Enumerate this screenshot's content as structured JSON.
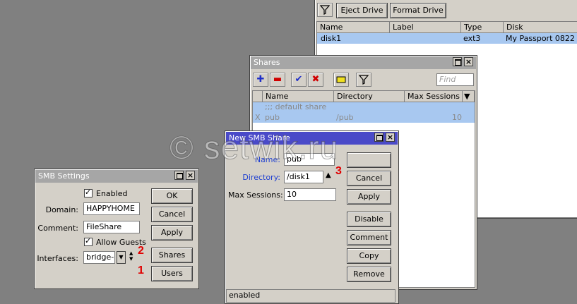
{
  "disks_window": {
    "toolbar": {
      "eject_label": "Eject Drive",
      "format_label": "Format Drive"
    },
    "columns": [
      "Name",
      "Label",
      "Type",
      "Disk"
    ],
    "rows": [
      {
        "name": "disk1",
        "label": "",
        "type": "ext3",
        "disk": "My Passport 0822"
      }
    ]
  },
  "shares_window": {
    "title": "Shares",
    "find_placeholder": "Find",
    "columns": [
      "Name",
      "Directory",
      "Max Sessions"
    ],
    "comment_row": ";;; default share",
    "rows": [
      {
        "flag": "X",
        "name": "pub",
        "directory": "/pub",
        "max_sessions": "10"
      }
    ]
  },
  "new_share_window": {
    "title": "New SMB Share",
    "name_label": "Name:",
    "name_value": "pub",
    "directory_label": "Directory:",
    "directory_value": "/disk1",
    "max_sessions_label": "Max Sessions:",
    "max_sessions_value": "10",
    "buttons": {
      "cancel": "Cancel",
      "apply": "Apply",
      "disable": "Disable",
      "comment": "Comment",
      "copy": "Copy",
      "remove": "Remove"
    },
    "status": "enabled"
  },
  "smb_settings_window": {
    "title": "SMB Settings",
    "enabled_label": "Enabled",
    "domain_label": "Domain:",
    "domain_value": "HAPPYHOME",
    "comment_label": "Comment:",
    "comment_value": "FileShare",
    "allow_guests_label": "Allow Guests",
    "interfaces_label": "Interfaces:",
    "interfaces_value": "bridge-lo",
    "buttons": {
      "ok": "OK",
      "cancel": "Cancel",
      "apply": "Apply",
      "shares": "Shares",
      "users": "Users"
    }
  },
  "annotations": {
    "one": "1",
    "two": "2",
    "three": "3"
  },
  "watermark": "© setwik.ru",
  "colors": {
    "active_title": "#4a4ac8",
    "inactive_title": "#a6a6a6",
    "selected_row": "#a8c8f0",
    "annotation": "#e00000"
  }
}
